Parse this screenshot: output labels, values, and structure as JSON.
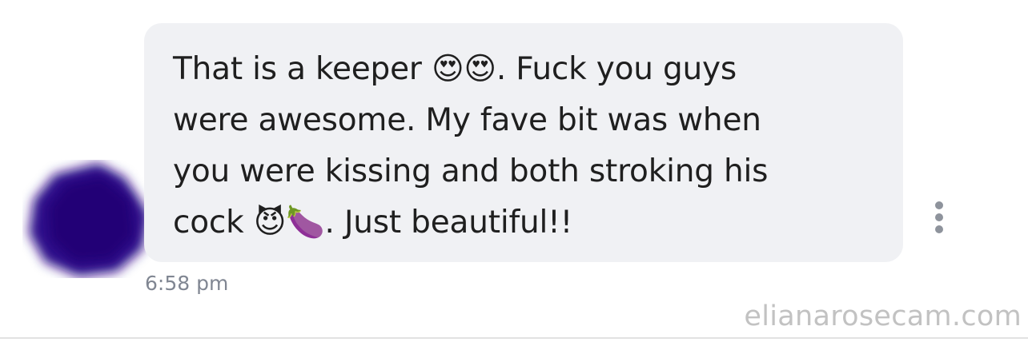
{
  "message": {
    "text": "That is a keeper 😍😍. Fuck you guys\nwere awesome. My fave bit was when\nyou were kissing and both stroking his\ncock 😈🍆. Just beautiful!!",
    "timestamp": "6:58 pm"
  },
  "avatar": {
    "icon": "blurred-avatar",
    "color": "#2e0a8a"
  },
  "menu": {
    "icon": "more-vertical-icon"
  },
  "watermark": "elianarosecam.com",
  "colors": {
    "bubble": "#f0f1f4",
    "text": "#1f1f1f",
    "timestamp": "#808692"
  }
}
